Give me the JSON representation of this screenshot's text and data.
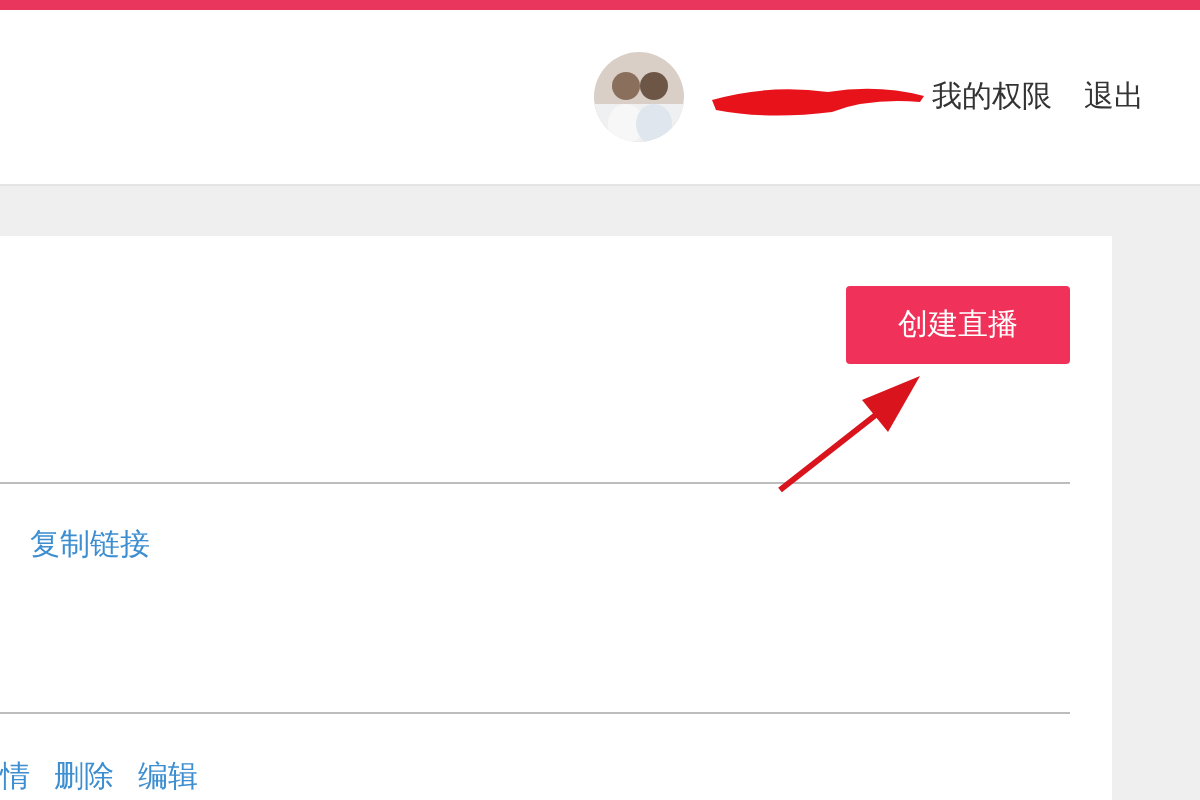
{
  "header": {
    "links": [
      {
        "label": "我的权限"
      },
      {
        "label": "退出"
      }
    ]
  },
  "card": {
    "create_button": "创建直播",
    "row_1_links": [
      "复制链接"
    ],
    "row_2_links": [
      "情",
      "删除",
      "编辑"
    ]
  }
}
